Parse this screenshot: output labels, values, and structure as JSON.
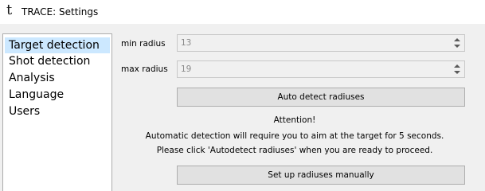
{
  "window": {
    "app_icon_glyph": "t",
    "title": "TRACE: Settings"
  },
  "sidebar": {
    "items": [
      {
        "label": "Target detection",
        "selected": true
      },
      {
        "label": "Shot detection",
        "selected": false
      },
      {
        "label": "Analysis",
        "selected": false
      },
      {
        "label": "Language",
        "selected": false
      },
      {
        "label": "Users",
        "selected": false
      }
    ]
  },
  "target_detection": {
    "min_radius": {
      "label": "min radius",
      "value": "13"
    },
    "max_radius": {
      "label": "max radius",
      "value": "19"
    },
    "auto_detect_button": "Auto detect radiuses",
    "attention_title": "Attention!",
    "attention_line1": "Automatic detection will require you to aim at the target for 5 seconds.",
    "attention_line2": "Please click 'Autodetect radiuses' when you are ready to proceed.",
    "manual_setup_button": "Set up radiuses manually"
  },
  "colors": {
    "selection": "#cce8ff",
    "window_bg": "#f0f0f0",
    "button_bg": "#e1e1e1"
  }
}
